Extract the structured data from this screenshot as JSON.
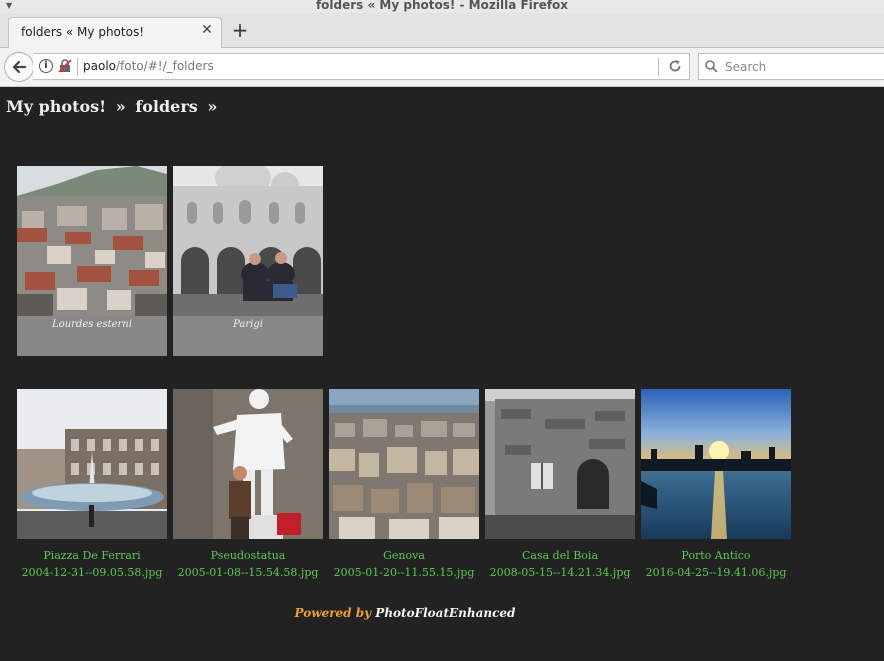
{
  "window": {
    "title": "folders « My photos! - Mozilla Firefox"
  },
  "tab": {
    "title": "folders « My photos!"
  },
  "address": {
    "host": "paolo",
    "path": "/foto/#!/_folders"
  },
  "search": {
    "placeholder": "Search"
  },
  "breadcrumb": {
    "site": "My photos!",
    "sep1": "»",
    "folder": "folders",
    "sep2": "»"
  },
  "albums": [
    {
      "caption": "Lourdes esterni"
    },
    {
      "caption": "Parigi"
    }
  ],
  "photos": [
    {
      "title": "Piazza De Ferrari",
      "filename": "2004-12-31--09.05.58.jpg"
    },
    {
      "title": "Pseudostatua",
      "filename": "2005-01-08--15.54.58.jpg"
    },
    {
      "title": "Genova",
      "filename": "2005-01-20--11.55.15.jpg"
    },
    {
      "title": "Casa del Boia",
      "filename": "2008-05-15--14.21.34.jpg"
    },
    {
      "title": "Porto Antico",
      "filename": "2016-04-25--19.41.06.jpg"
    }
  ],
  "footer": {
    "powered": "Powered by",
    "product": "PhotoFloatEnhanced"
  },
  "colors": {
    "background": "#222222",
    "photo_text": "#59c94f",
    "powered": "#f0a030"
  }
}
